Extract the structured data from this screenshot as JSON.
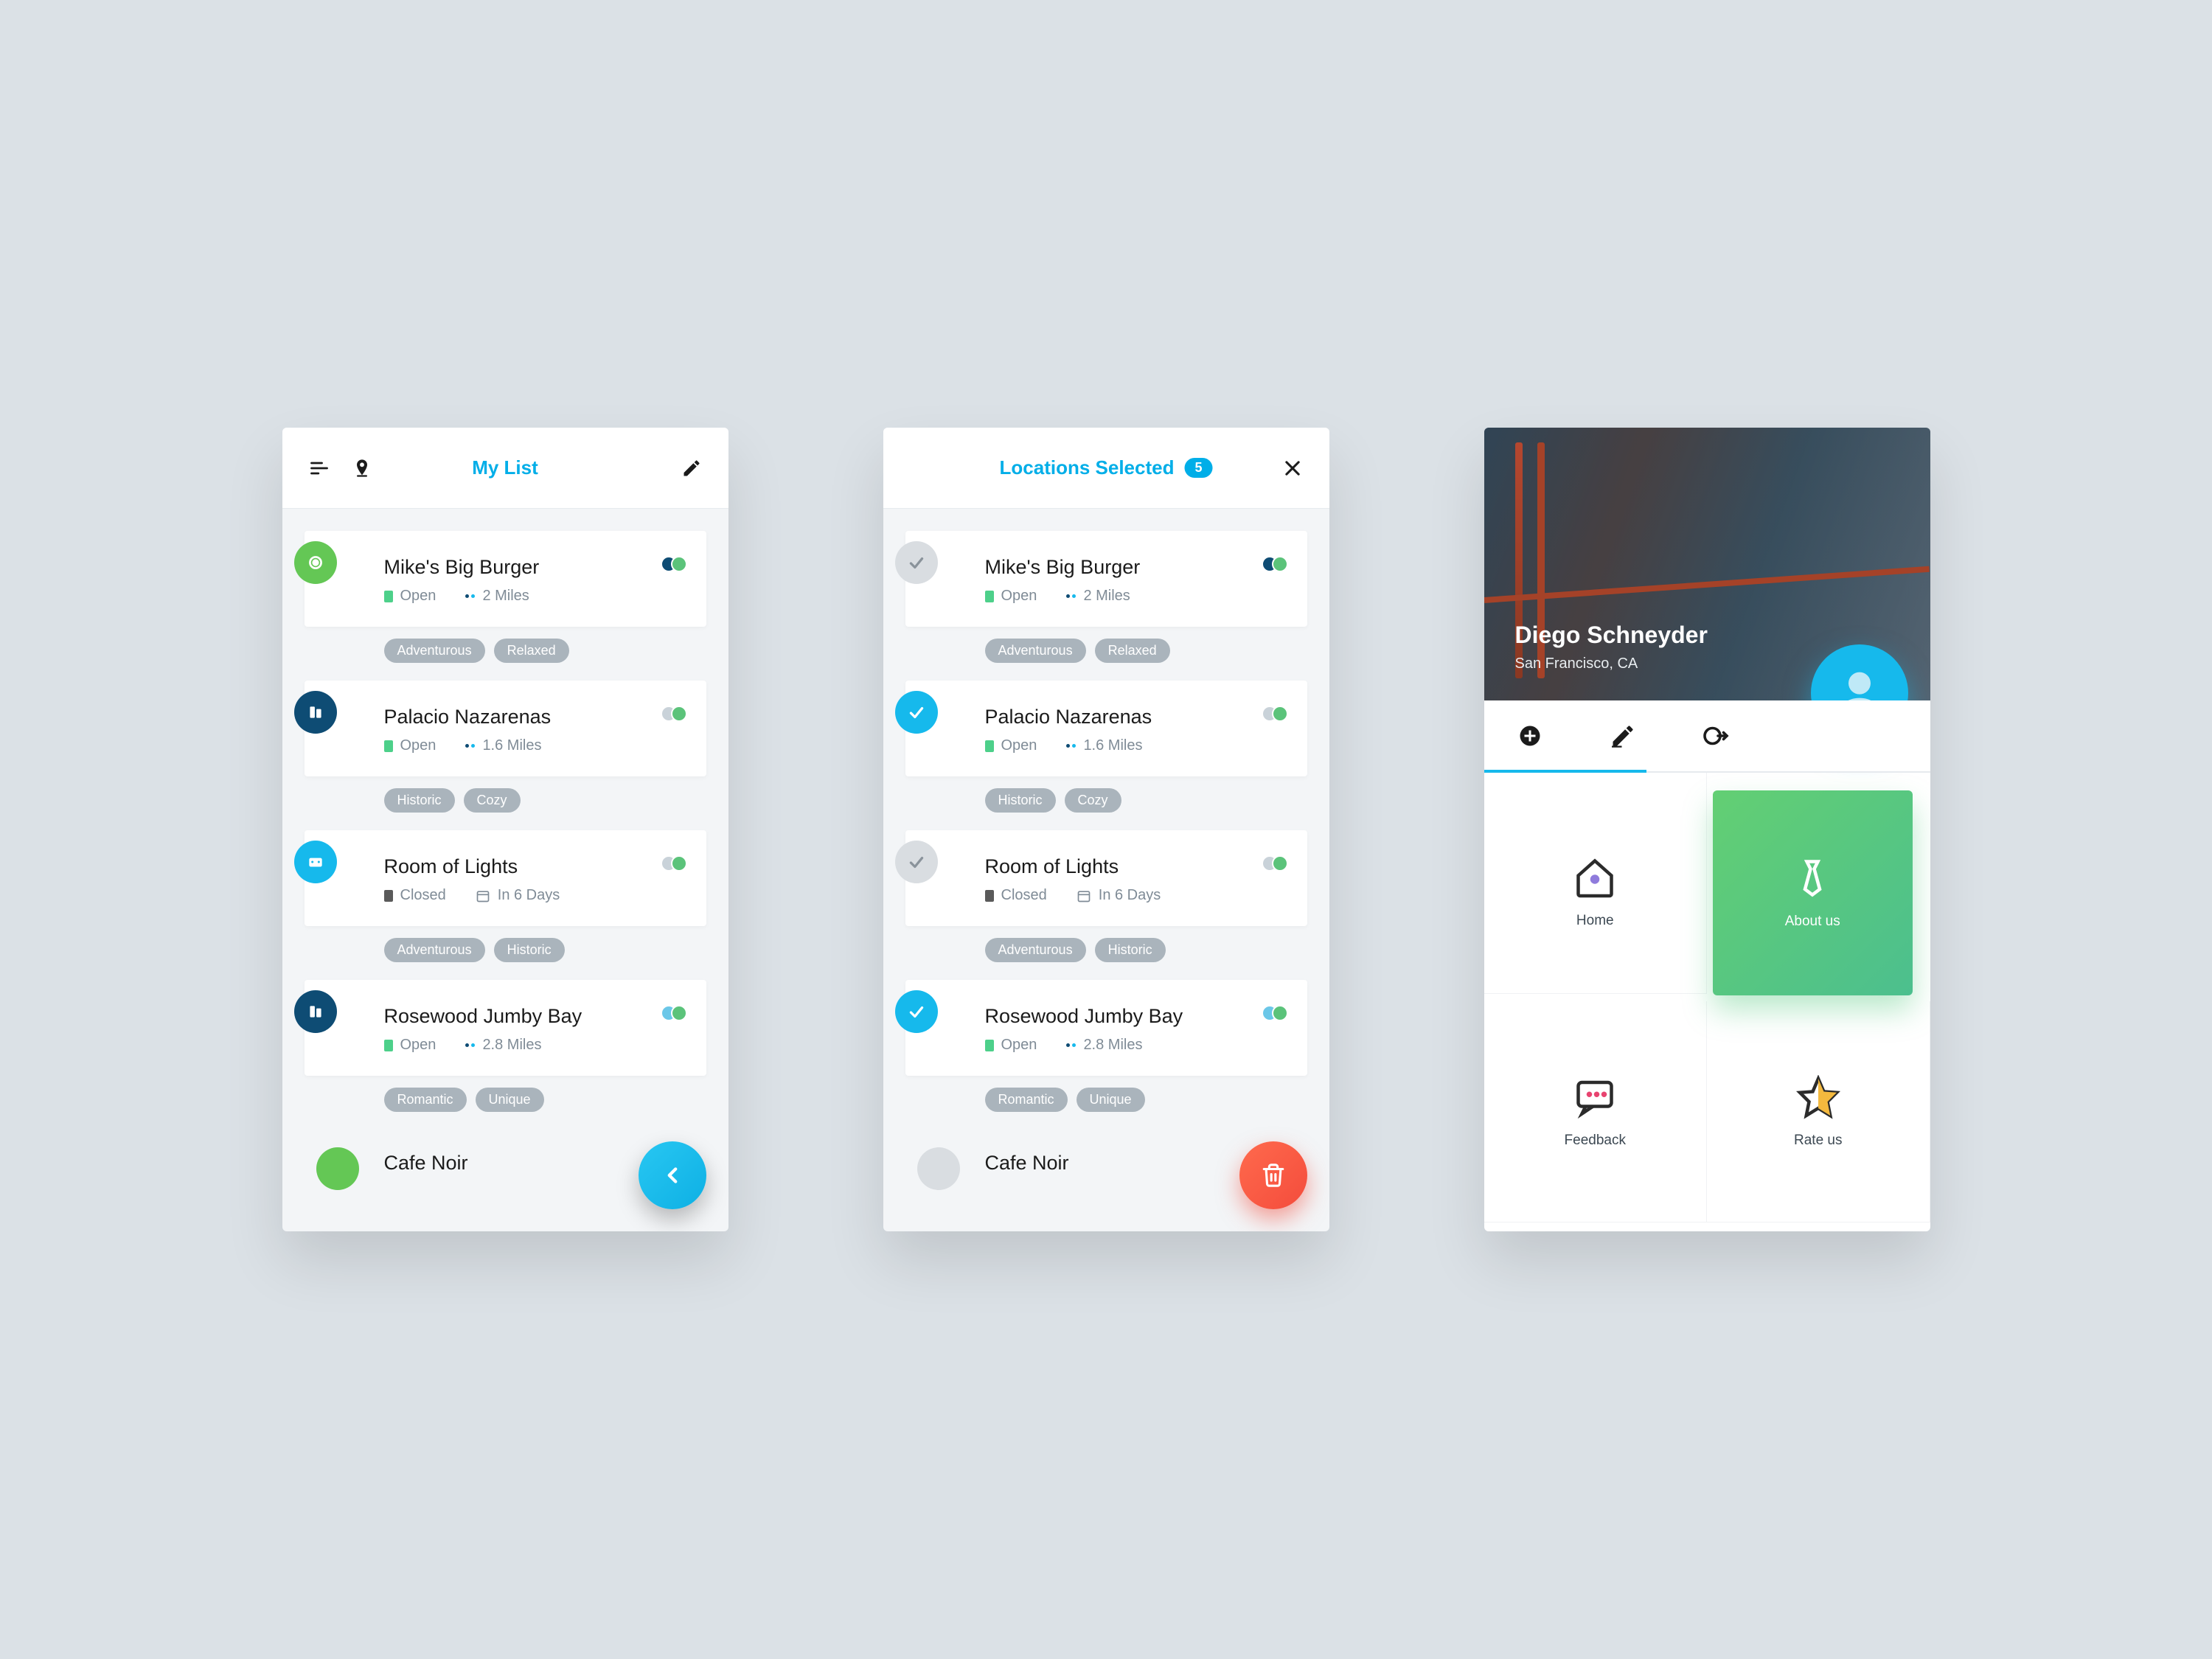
{
  "colors": {
    "accent": "#00aee8",
    "danger": "#f44c3c"
  },
  "screen1": {
    "title": "My List",
    "fab_icon": "chevron-left",
    "items": [
      {
        "name": "Mike's Big Burger",
        "status": "Open",
        "secondary": "2 Miles",
        "badge_color": "green",
        "tags": [
          "Adventurous",
          "Relaxed"
        ]
      },
      {
        "name": "Palacio Nazarenas",
        "status": "Open",
        "secondary": "1.6 Miles",
        "badge_color": "navy",
        "tags": [
          "Historic",
          "Cozy"
        ]
      },
      {
        "name": "Room of Lights",
        "status": "Closed",
        "secondary": "In 6 Days",
        "badge_color": "cyan",
        "tags": [
          "Adventurous",
          "Historic"
        ]
      },
      {
        "name": "Rosewood Jumby Bay",
        "status": "Open",
        "secondary": "2.8 Miles",
        "badge_color": "navy",
        "tags": [
          "Romantic",
          "Unique"
        ]
      },
      {
        "name": "Cafe Noir",
        "status": "",
        "secondary": "",
        "badge_color": "green",
        "tags": []
      }
    ]
  },
  "screen2": {
    "title": "Locations Selected",
    "count": "5",
    "fab_icon": "trash",
    "items": [
      {
        "name": "Mike's Big Burger",
        "status": "Open",
        "secondary": "2 Miles",
        "selected": false,
        "tags": [
          "Adventurous",
          "Relaxed"
        ]
      },
      {
        "name": "Palacio Nazarenas",
        "status": "Open",
        "secondary": "1.6 Miles",
        "selected": true,
        "tags": [
          "Historic",
          "Cozy"
        ]
      },
      {
        "name": "Room of Lights",
        "status": "Closed",
        "secondary": "In 6 Days",
        "selected": false,
        "tags": [
          "Adventurous",
          "Historic"
        ]
      },
      {
        "name": "Rosewood Jumby Bay",
        "status": "Open",
        "secondary": "2.8 Miles",
        "selected": true,
        "tags": [
          "Romantic",
          "Unique"
        ]
      },
      {
        "name": "Cafe Noir",
        "status": "",
        "secondary": "",
        "selected": false,
        "tags": []
      }
    ]
  },
  "screen3": {
    "profile": {
      "name": "Diego Schneyder",
      "location": "San Francisco, CA"
    },
    "actions": [
      "add",
      "edit",
      "logout"
    ],
    "tiles": [
      {
        "icon": "home",
        "label": "Home"
      },
      {
        "icon": "tie",
        "label": "About us"
      },
      {
        "icon": "chat",
        "label": "Feedback"
      },
      {
        "icon": "star",
        "label": "Rate us"
      }
    ]
  }
}
